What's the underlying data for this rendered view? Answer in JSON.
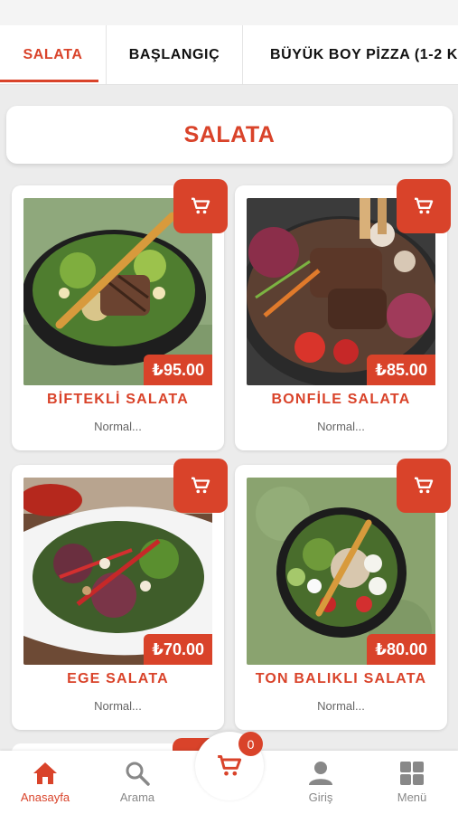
{
  "tabs": [
    {
      "label": "SALATA",
      "active": true
    },
    {
      "label": "BAŞLANGIÇ",
      "active": false
    },
    {
      "label": "BÜYÜK BOY PİZZA (1-2 Kİ",
      "active": false
    }
  ],
  "section": {
    "title": "SALATA"
  },
  "products": [
    {
      "name": "BİFTEKLİ SALATA",
      "price": "₺95.00",
      "desc": "Normal..."
    },
    {
      "name": "BONFİLE SALATA",
      "price": "₺85.00",
      "desc": "Normal..."
    },
    {
      "name": "EGE SALATA",
      "price": "₺70.00",
      "desc": "Normal..."
    },
    {
      "name": "TON BALIKLI SALATA",
      "price": "₺80.00",
      "desc": "Normal..."
    }
  ],
  "nav": {
    "home": "Anasayfa",
    "search": "Arama",
    "cart_count": "0",
    "login": "Giriş",
    "menu": "Menü"
  },
  "colors": {
    "accent": "#d9432a",
    "background": "#ececec"
  },
  "icons": [
    "cart-icon",
    "home-icon",
    "search-icon",
    "user-icon",
    "grid-icon"
  ]
}
